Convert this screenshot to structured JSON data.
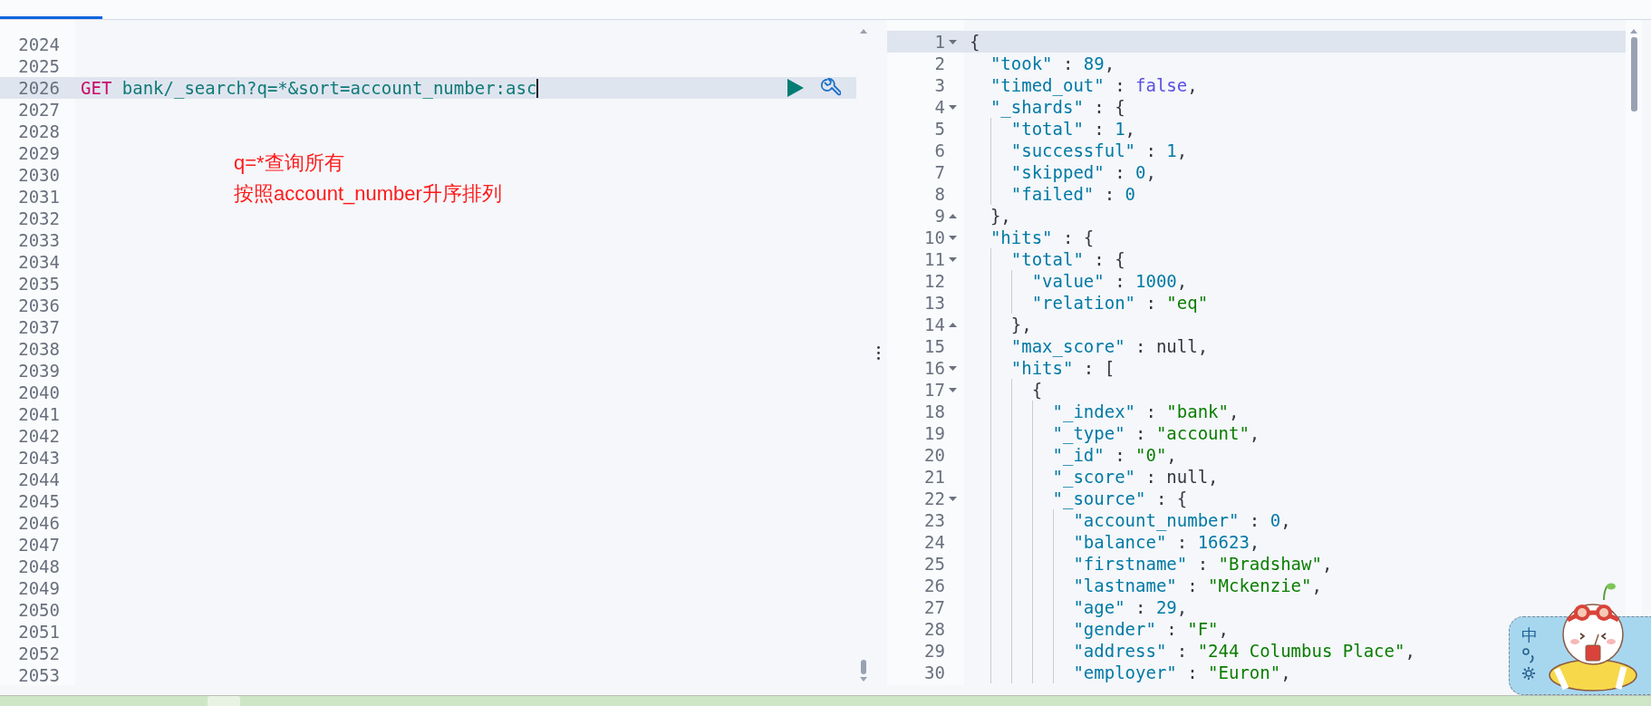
{
  "editor": {
    "lines": [
      {
        "number": "2024",
        "active": false
      },
      {
        "number": "2025",
        "active": false
      },
      {
        "number": "2026",
        "active": true,
        "tokens": [
          {
            "kind": "method",
            "text": "GET"
          },
          {
            "kind": "path",
            "text": "bank/_search?q=*&sort=account_number:asc"
          }
        ]
      },
      {
        "number": "2027",
        "active": false
      },
      {
        "number": "2028",
        "active": false
      },
      {
        "number": "2029",
        "active": false
      },
      {
        "number": "2030",
        "active": false
      },
      {
        "number": "2031",
        "active": false
      },
      {
        "number": "2032",
        "active": false
      },
      {
        "number": "2033",
        "active": false
      },
      {
        "number": "2034",
        "active": false
      },
      {
        "number": "2035",
        "active": false
      },
      {
        "number": "2036",
        "active": false
      },
      {
        "number": "2037",
        "active": false
      },
      {
        "number": "2038",
        "active": false
      },
      {
        "number": "2039",
        "active": false
      },
      {
        "number": "2040",
        "active": false
      },
      {
        "number": "2041",
        "active": false
      },
      {
        "number": "2042",
        "active": false
      },
      {
        "number": "2043",
        "active": false
      },
      {
        "number": "2044",
        "active": false
      },
      {
        "number": "2045",
        "active": false
      },
      {
        "number": "2046",
        "active": false
      },
      {
        "number": "2047",
        "active": false
      },
      {
        "number": "2048",
        "active": false
      },
      {
        "number": "2049",
        "active": false
      },
      {
        "number": "2050",
        "active": false
      },
      {
        "number": "2051",
        "active": false
      },
      {
        "number": "2052",
        "active": false
      },
      {
        "number": "2053",
        "active": false
      }
    ]
  },
  "annotation": {
    "lines": [
      "q=*查询所有",
      "按照account_number升序排列"
    ]
  },
  "output": {
    "lines": [
      {
        "number": "1",
        "active": true,
        "kind": "fold_start",
        "tokens": [
          {
            "kind": "punct",
            "text": "{"
          }
        ]
      },
      {
        "number": "2",
        "active": false,
        "kind": "plain",
        "tokens": [
          {
            "kind": "key",
            "text": "\"took\""
          },
          {
            "kind": "punct",
            "text": " : "
          },
          {
            "kind": "number",
            "text": "89"
          },
          {
            "kind": "punct",
            "text": ","
          }
        ]
      },
      {
        "number": "3",
        "active": false,
        "kind": "plain",
        "tokens": [
          {
            "kind": "key",
            "text": "\"timed_out\""
          },
          {
            "kind": "punct",
            "text": " : "
          },
          {
            "kind": "boolean",
            "text": "false"
          },
          {
            "kind": "punct",
            "text": ","
          }
        ]
      },
      {
        "number": "4",
        "active": false,
        "kind": "fold_start",
        "tokens": [
          {
            "kind": "key",
            "text": "\"_shards\""
          },
          {
            "kind": "punct",
            "text": " : {"
          }
        ]
      },
      {
        "number": "5",
        "active": false,
        "kind": "plain",
        "tokens": [
          {
            "kind": "key",
            "text": "\"total\""
          },
          {
            "kind": "punct",
            "text": " : "
          },
          {
            "kind": "number",
            "text": "1"
          },
          {
            "kind": "punct",
            "text": ","
          }
        ]
      },
      {
        "number": "6",
        "active": false,
        "kind": "plain",
        "tokens": [
          {
            "kind": "key",
            "text": "\"successful\""
          },
          {
            "kind": "punct",
            "text": " : "
          },
          {
            "kind": "number",
            "text": "1"
          },
          {
            "kind": "punct",
            "text": ","
          }
        ]
      },
      {
        "number": "7",
        "active": false,
        "kind": "plain",
        "tokens": [
          {
            "kind": "key",
            "text": "\"skipped\""
          },
          {
            "kind": "punct",
            "text": " : "
          },
          {
            "kind": "number",
            "text": "0"
          },
          {
            "kind": "punct",
            "text": ","
          }
        ]
      },
      {
        "number": "8",
        "active": false,
        "kind": "plain",
        "tokens": [
          {
            "kind": "key",
            "text": "\"failed\""
          },
          {
            "kind": "punct",
            "text": " : "
          },
          {
            "kind": "number",
            "text": "0"
          }
        ]
      },
      {
        "number": "9",
        "active": false,
        "kind": "fold_end",
        "tokens": [
          {
            "kind": "punct",
            "text": "},"
          }
        ]
      },
      {
        "number": "10",
        "active": false,
        "kind": "fold_start",
        "tokens": [
          {
            "kind": "key",
            "text": "\"hits\""
          },
          {
            "kind": "punct",
            "text": " : {"
          }
        ]
      },
      {
        "number": "11",
        "active": false,
        "kind": "fold_start",
        "tokens": [
          {
            "kind": "key",
            "text": "\"total\""
          },
          {
            "kind": "punct",
            "text": " : {"
          }
        ]
      },
      {
        "number": "12",
        "active": false,
        "kind": "plain",
        "tokens": [
          {
            "kind": "key",
            "text": "\"value\""
          },
          {
            "kind": "punct",
            "text": " : "
          },
          {
            "kind": "number",
            "text": "1000"
          },
          {
            "kind": "punct",
            "text": ","
          }
        ]
      },
      {
        "number": "13",
        "active": false,
        "kind": "plain",
        "tokens": [
          {
            "kind": "key",
            "text": "\"relation\""
          },
          {
            "kind": "punct",
            "text": " : "
          },
          {
            "kind": "string",
            "text": "\"eq\""
          }
        ]
      },
      {
        "number": "14",
        "active": false,
        "kind": "fold_end",
        "tokens": [
          {
            "kind": "punct",
            "text": "},"
          }
        ]
      },
      {
        "number": "15",
        "active": false,
        "kind": "plain",
        "tokens": [
          {
            "kind": "key",
            "text": "\"max_score\""
          },
          {
            "kind": "punct",
            "text": " : "
          },
          {
            "kind": "null",
            "text": "null"
          },
          {
            "kind": "punct",
            "text": ","
          }
        ]
      },
      {
        "number": "16",
        "active": false,
        "kind": "fold_start",
        "tokens": [
          {
            "kind": "key",
            "text": "\"hits\""
          },
          {
            "kind": "punct",
            "text": " : ["
          }
        ]
      },
      {
        "number": "17",
        "active": false,
        "kind": "fold_start",
        "tokens": [
          {
            "kind": "punct",
            "text": "{"
          }
        ]
      },
      {
        "number": "18",
        "active": false,
        "kind": "plain",
        "tokens": [
          {
            "kind": "key",
            "text": "\"_index\""
          },
          {
            "kind": "punct",
            "text": " : "
          },
          {
            "kind": "string",
            "text": "\"bank\""
          },
          {
            "kind": "punct",
            "text": ","
          }
        ]
      },
      {
        "number": "19",
        "active": false,
        "kind": "plain",
        "tokens": [
          {
            "kind": "key",
            "text": "\"_type\""
          },
          {
            "kind": "punct",
            "text": " : "
          },
          {
            "kind": "string",
            "text": "\"account\""
          },
          {
            "kind": "punct",
            "text": ","
          }
        ]
      },
      {
        "number": "20",
        "active": false,
        "kind": "plain",
        "tokens": [
          {
            "kind": "key",
            "text": "\"_id\""
          },
          {
            "kind": "punct",
            "text": " : "
          },
          {
            "kind": "string",
            "text": "\"0\""
          },
          {
            "kind": "punct",
            "text": ","
          }
        ]
      },
      {
        "number": "21",
        "active": false,
        "kind": "plain",
        "tokens": [
          {
            "kind": "key",
            "text": "\"_score\""
          },
          {
            "kind": "punct",
            "text": " : "
          },
          {
            "kind": "null",
            "text": "null"
          },
          {
            "kind": "punct",
            "text": ","
          }
        ]
      },
      {
        "number": "22",
        "active": false,
        "kind": "fold_start",
        "tokens": [
          {
            "kind": "key",
            "text": "\"_source\""
          },
          {
            "kind": "punct",
            "text": " : {"
          }
        ]
      },
      {
        "number": "23",
        "active": false,
        "kind": "plain",
        "tokens": [
          {
            "kind": "key",
            "text": "\"account_number\""
          },
          {
            "kind": "punct",
            "text": " : "
          },
          {
            "kind": "number",
            "text": "0"
          },
          {
            "kind": "punct",
            "text": ","
          }
        ]
      },
      {
        "number": "24",
        "active": false,
        "kind": "plain",
        "tokens": [
          {
            "kind": "key",
            "text": "\"balance\""
          },
          {
            "kind": "punct",
            "text": " : "
          },
          {
            "kind": "number",
            "text": "16623"
          },
          {
            "kind": "punct",
            "text": ","
          }
        ]
      },
      {
        "number": "25",
        "active": false,
        "kind": "plain",
        "tokens": [
          {
            "kind": "key",
            "text": "\"firstname\""
          },
          {
            "kind": "punct",
            "text": " : "
          },
          {
            "kind": "string",
            "text": "\"Bradshaw\""
          },
          {
            "kind": "punct",
            "text": ","
          }
        ]
      },
      {
        "number": "26",
        "active": false,
        "kind": "plain",
        "tokens": [
          {
            "kind": "key",
            "text": "\"lastname\""
          },
          {
            "kind": "punct",
            "text": " : "
          },
          {
            "kind": "string",
            "text": "\"Mckenzie\""
          },
          {
            "kind": "punct",
            "text": ","
          }
        ]
      },
      {
        "number": "27",
        "active": false,
        "kind": "plain",
        "tokens": [
          {
            "kind": "key",
            "text": "\"age\""
          },
          {
            "kind": "punct",
            "text": " : "
          },
          {
            "kind": "number",
            "text": "29"
          },
          {
            "kind": "punct",
            "text": ","
          }
        ]
      },
      {
        "number": "28",
        "active": false,
        "kind": "plain",
        "tokens": [
          {
            "kind": "key",
            "text": "\"gender\""
          },
          {
            "kind": "punct",
            "text": " : "
          },
          {
            "kind": "string",
            "text": "\"F\""
          },
          {
            "kind": "punct",
            "text": ","
          }
        ]
      },
      {
        "number": "29",
        "active": false,
        "kind": "plain",
        "tokens": [
          {
            "kind": "key",
            "text": "\"address\""
          },
          {
            "kind": "punct",
            "text": " : "
          },
          {
            "kind": "string",
            "text": "\"244 Columbus Place\""
          },
          {
            "kind": "punct",
            "text": ","
          }
        ]
      },
      {
        "number": "30",
        "active": false,
        "kind": "plain",
        "tokens": [
          {
            "kind": "key",
            "text": "\"employer\""
          },
          {
            "kind": "punct",
            "text": " : "
          },
          {
            "kind": "string",
            "text": "\"Euron\""
          },
          {
            "kind": "punct",
            "text": ","
          }
        ]
      }
    ]
  },
  "ime": {
    "mode": "中"
  }
}
